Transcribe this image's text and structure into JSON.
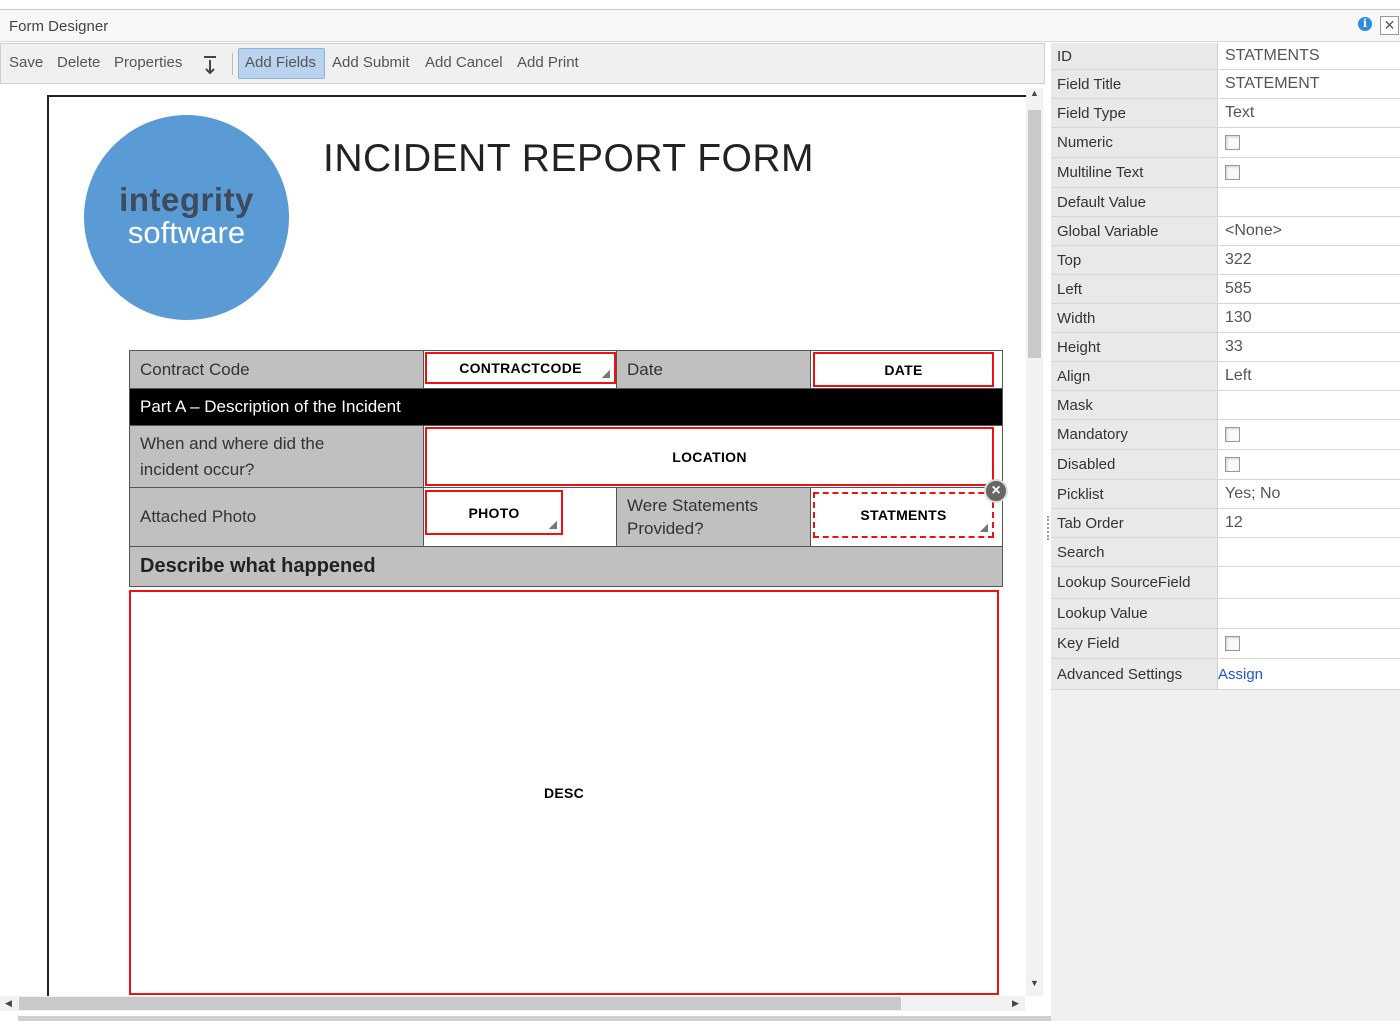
{
  "window": {
    "title": "Form Designer",
    "info_icon": "i",
    "close_icon": "✕"
  },
  "toolbar": {
    "save": "Save",
    "delete": "Delete",
    "properties": "Properties",
    "add_fields": "Add Fields",
    "add_submit": "Add Submit",
    "add_cancel": "Add Cancel",
    "add_print": "Add Print"
  },
  "form": {
    "logo_line1": "integrity",
    "logo_line2": "software",
    "title": "INCIDENT REPORT FORM",
    "labels": {
      "contract_code": "Contract Code",
      "date": "Date",
      "part_a": "Part A – Description of the Incident",
      "when_where": "When and where did the incident occur?",
      "attached_photo": "Attached Photo",
      "statements": "Were Statements Provided?",
      "describe": "Describe what happened"
    },
    "fields": {
      "contractcode": "CONTRACTCODE",
      "date": "DATE",
      "location": "LOCATION",
      "photo": "PHOTO",
      "statments": "STATMENTS",
      "desc": "DESC"
    }
  },
  "properties": [
    {
      "key": "ID",
      "value": "STATMENTS",
      "type": "text"
    },
    {
      "key": "Field Title",
      "value": "STATEMENT",
      "type": "text"
    },
    {
      "key": "Field Type",
      "value": "Text",
      "type": "text"
    },
    {
      "key": "Numeric",
      "value": "",
      "type": "checkbox"
    },
    {
      "key": "Multiline Text",
      "value": "",
      "type": "checkbox"
    },
    {
      "key": "Default Value",
      "value": "",
      "type": "text"
    },
    {
      "key": "Global Variable",
      "value": "<None>",
      "type": "text"
    },
    {
      "key": "Top",
      "value": "322",
      "type": "text"
    },
    {
      "key": "Left",
      "value": "585",
      "type": "text"
    },
    {
      "key": "Width",
      "value": "130",
      "type": "text"
    },
    {
      "key": "Height",
      "value": "33",
      "type": "text"
    },
    {
      "key": "Align",
      "value": "Left",
      "type": "text"
    },
    {
      "key": "Mask",
      "value": "",
      "type": "text"
    },
    {
      "key": "Mandatory",
      "value": "",
      "type": "checkbox"
    },
    {
      "key": "Disabled",
      "value": "",
      "type": "checkbox"
    },
    {
      "key": "Picklist",
      "value": "Yes; No",
      "type": "text"
    },
    {
      "key": "Tab Order",
      "value": "12",
      "type": "text"
    },
    {
      "key": "Search",
      "value": "",
      "type": "text"
    },
    {
      "key": "Lookup SourceField",
      "value": "",
      "type": "text"
    },
    {
      "key": "Lookup Value",
      "value": "",
      "type": "text"
    },
    {
      "key": "Key Field",
      "value": "",
      "type": "checkbox"
    },
    {
      "key": "Advanced Settings",
      "value": "Assign",
      "type": "link"
    }
  ],
  "colors": {
    "accent": "#b9d3ee",
    "field_border": "#ee1111",
    "logo": "#5b9bd5",
    "link": "#2255cc"
  }
}
